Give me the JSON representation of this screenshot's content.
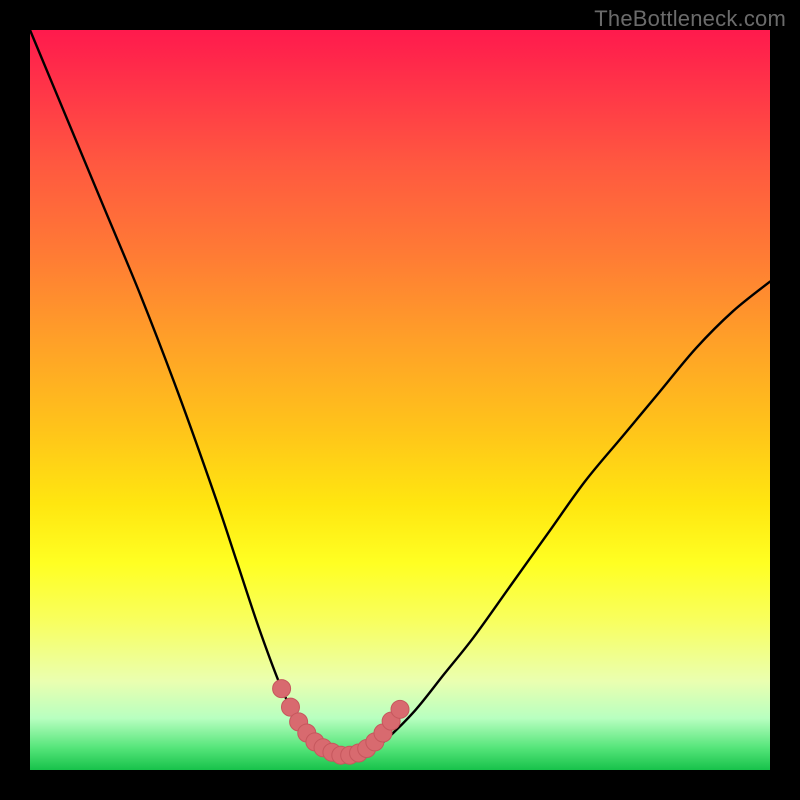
{
  "watermark": "TheBottleneck.com",
  "colors": {
    "curve_stroke": "#000000",
    "marker_fill": "#d86a6f",
    "marker_stroke": "#c6575d"
  },
  "chart_data": {
    "type": "line",
    "title": "",
    "xlabel": "",
    "ylabel": "",
    "xlim": [
      0,
      100
    ],
    "ylim": [
      0,
      100
    ],
    "series": [
      {
        "name": "bottleneck-curve",
        "x": [
          0,
          5,
          10,
          15,
          20,
          25,
          28,
          31,
          34,
          36,
          38,
          40,
          42,
          44,
          46,
          48,
          52,
          56,
          60,
          65,
          70,
          75,
          80,
          85,
          90,
          95,
          100
        ],
        "y": [
          100,
          88,
          76,
          64,
          51,
          37,
          28,
          19,
          11,
          7,
          4,
          2.5,
          2,
          2,
          2.5,
          4,
          8,
          13,
          18,
          25,
          32,
          39,
          45,
          51,
          57,
          62,
          66
        ]
      }
    ],
    "markers": {
      "name": "highlight-bottom",
      "x": [
        34,
        35.2,
        36.3,
        37.4,
        38.5,
        39.6,
        40.8,
        42.0,
        43.2,
        44.4,
        45.5,
        46.6,
        47.7,
        48.8,
        50.0
      ],
      "y": [
        11,
        8.5,
        6.5,
        5,
        3.8,
        3,
        2.4,
        2,
        2,
        2.3,
        2.9,
        3.8,
        5,
        6.6,
        8.2
      ]
    }
  }
}
